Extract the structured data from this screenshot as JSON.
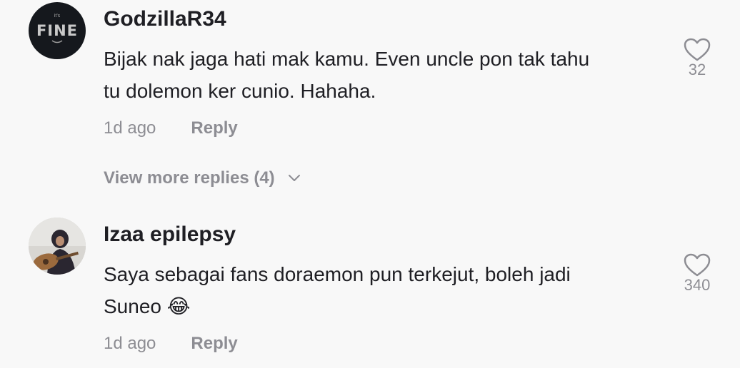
{
  "comments": [
    {
      "avatar_text": "FINE",
      "avatar_small": "it's",
      "username": "GodzillaR34",
      "text_line1": "Bijak nak jaga hati mak kamu. Even uncle pon tak tahu",
      "text_line2": "tu dolemon ker cunio. Hahaha.",
      "time": "1d ago",
      "reply_label": "Reply",
      "likes": "32",
      "more_replies": "View more replies (4)"
    },
    {
      "username": "Izaa epilepsy",
      "text_line1": "Saya sebagai fans doraemon pun terkejut, boleh jadi",
      "text_line2": "Suneo",
      "emoji": "😂",
      "time": "1d ago",
      "reply_label": "Reply",
      "likes": "340"
    }
  ],
  "icons": {
    "like": "heart-outline-icon",
    "expand": "chevron-down-icon"
  },
  "colors": {
    "background": "#f8f8f8",
    "primary_text": "#1f1f24",
    "secondary_text": "#8d8d93"
  }
}
